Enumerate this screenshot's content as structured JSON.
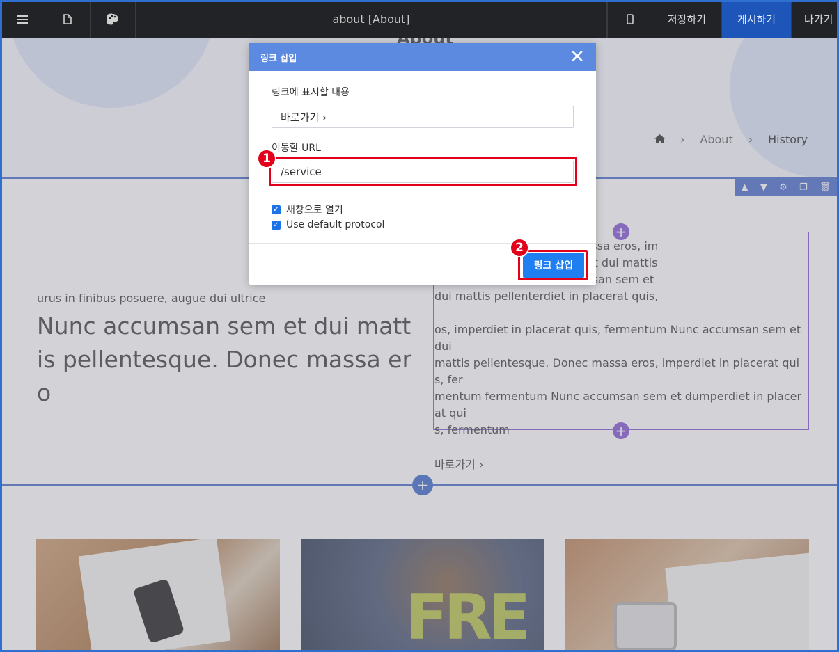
{
  "topbar": {
    "menu_icon": "menu-icon",
    "page_icon": "document-icon",
    "theme_icon": "palette-icon",
    "title": "about [About]",
    "device_icon": "mobile-icon",
    "save_label": "저장하기",
    "publish_label": "게시하기",
    "exit_label": "나가기"
  },
  "page": {
    "hero_title": "About",
    "breadcrumb": {
      "home_icon": "home-icon",
      "items": [
        "About",
        "History"
      ],
      "separator": "›"
    },
    "section_tools": [
      "chevron-up-icon",
      "chevron-down-icon",
      "gear-icon",
      "copy-icon",
      "trash-icon"
    ],
    "subtitle": "urus in finibus posuere, augue dui ultrice",
    "headline": "Nunc accumsan sem et dui mattis pellentesque. Donec massa ero",
    "paragraph1": [
      "ttis pellentesque. Donec massa eros, im",
      "ntum Nunc accumsan sem et dui mattis",
      "uis, fermentum Nunc accumsan sem et",
      "dui mattis pellenterdiet in placerat quis,"
    ],
    "paragraph2": [
      " os, imperdiet in placerat quis, fermentum Nunc accumsan sem et dui",
      "mattis pellentesque. Donec massa eros, imperdiet in placerat quis, fer",
      "mentum fermentum Nunc accumsan sem et dumperdiet in placerat qui",
      "s, fermentum"
    ],
    "link_text": "바로가기 ›",
    "add_symbol": "+"
  },
  "modal": {
    "title": "링크 삽입",
    "close_label": "✕",
    "display_label": "링크에 표시할 내용",
    "display_value": "바로가기 ›",
    "url_label": "이동할 URL",
    "url_value": "/service",
    "checkbox_new_window": "새창으로 열기",
    "checkbox_default_protocol": "Use default protocol",
    "new_window_checked": true,
    "default_protocol_checked": true,
    "insert_button": "링크 삽입"
  },
  "annotations": {
    "badge1": "1",
    "badge2": "2",
    "highlight_color": "#e3001b"
  }
}
